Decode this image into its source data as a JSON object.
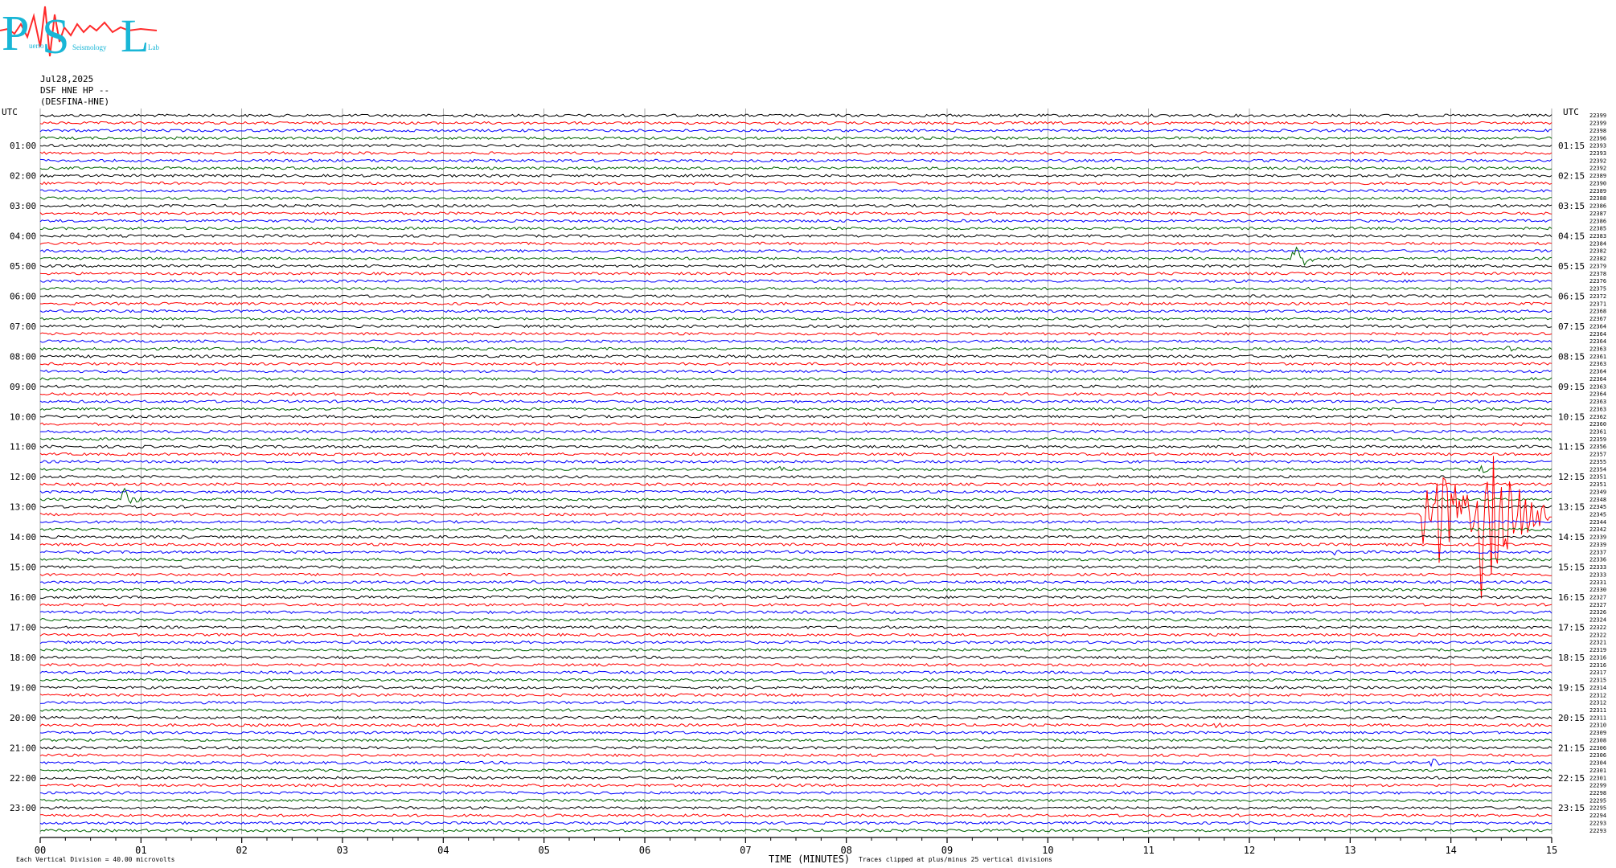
{
  "logo": {
    "letters": [
      "P",
      "S",
      "L"
    ],
    "words": [
      "uerto",
      "Seismology",
      "Lab"
    ]
  },
  "header": {
    "date": "Jul28,2025",
    "station": "DSF HNE HP --",
    "channel": "(DESFINA-HNE)"
  },
  "chart_data": {
    "type": "line",
    "title": "",
    "left_axis_label": "UTC",
    "right_axis_label": "UTC",
    "left_hour_labels": [
      "01:00",
      "02:00",
      "03:00",
      "04:00",
      "05:00",
      "06:00",
      "07:00",
      "08:00",
      "09:00",
      "10:00",
      "11:00",
      "12:00",
      "13:00",
      "14:00",
      "15:00",
      "16:00",
      "17:00",
      "18:00",
      "19:00",
      "20:00",
      "21:00",
      "22:00",
      "23:00"
    ],
    "right_hour_labels": [
      "01:15",
      "02:15",
      "03:15",
      "04:15",
      "05:15",
      "06:15",
      "07:15",
      "08:15",
      "09:15",
      "10:15",
      "11:15",
      "12:15",
      "13:15",
      "14:15",
      "15:15",
      "16:15",
      "17:15",
      "18:15",
      "19:15",
      "20:15",
      "21:15",
      "22:15",
      "23:15"
    ],
    "trace_count": 96,
    "trace_minutes": 15,
    "trace_colors": [
      "#000000",
      "#ff0000",
      "#0000ff",
      "#006400"
    ],
    "right_counts": [
      22399,
      22399,
      22398,
      22396,
      22393,
      22393,
      22392,
      22392,
      22389,
      22390,
      22389,
      22388,
      22386,
      22387,
      22386,
      22385,
      22383,
      22384,
      22382,
      22382,
      22379,
      22378,
      22376,
      22375,
      22372,
      22371,
      22368,
      22367,
      22364,
      22364,
      22364,
      22363,
      22361,
      22363,
      22364,
      22364,
      22363,
      22364,
      22363,
      22363,
      22362,
      22360,
      22361,
      22359,
      22356,
      22357,
      22355,
      22354,
      22351,
      22351,
      22349,
      22348,
      22345,
      22345,
      22344,
      22342,
      22339,
      22339,
      22337,
      22336,
      22333,
      22333,
      22331,
      22330,
      22327,
      22327,
      22326,
      22324,
      22322,
      22322,
      22321,
      22319,
      22316,
      22316,
      22317,
      22315,
      22314,
      22312,
      22312,
      22311,
      22311,
      22310,
      22309,
      22308,
      22306,
      22306,
      22304,
      22301,
      22301,
      22299,
      22298,
      22295,
      22295,
      22294,
      22293,
      22293
    ],
    "x_ticks": [
      "00",
      "01",
      "02",
      "03",
      "04",
      "05",
      "06",
      "07",
      "08",
      "09",
      "10",
      "11",
      "12",
      "13",
      "14",
      "15"
    ],
    "xlabel": "TIME (MINUTES)",
    "xlim": [
      0,
      15
    ],
    "x_minor_per_minute": 4,
    "grid": true,
    "vertical_division_note": "Each Vertical Division =    40.00 microvolts",
    "clip_note": "Traces clipped at plus/minus 25 vertical divisions",
    "events": [
      {
        "trace": 19,
        "minute": 12.45,
        "amplitude": 18,
        "duration": 0.35
      },
      {
        "trace": 53,
        "minute": 13.75,
        "amplitude": 95,
        "duration": 0.9
      },
      {
        "trace": 53,
        "minute": 14.3,
        "amplitude": 110,
        "duration": 0.9
      },
      {
        "trace": 51,
        "minute": 0.83,
        "amplitude": 16,
        "duration": 0.25
      },
      {
        "trace": 47,
        "minute": 7.35,
        "amplitude": 5,
        "duration": 0.2
      },
      {
        "trace": 58,
        "minute": 12.85,
        "amplitude": 6,
        "duration": 0.3
      },
      {
        "trace": 31,
        "minute": 14.55,
        "amplitude": 6,
        "duration": 0.2
      },
      {
        "trace": 86,
        "minute": 13.82,
        "amplitude": 7,
        "duration": 0.25
      },
      {
        "trace": 81,
        "minute": 11.68,
        "amplitude": 5,
        "duration": 0.2
      },
      {
        "trace": 56,
        "minute": 1.42,
        "amplitude": 4,
        "duration": 0.25
      },
      {
        "trace": 47,
        "minute": 14.3,
        "amplitude": 6,
        "duration": 0.2
      }
    ]
  }
}
